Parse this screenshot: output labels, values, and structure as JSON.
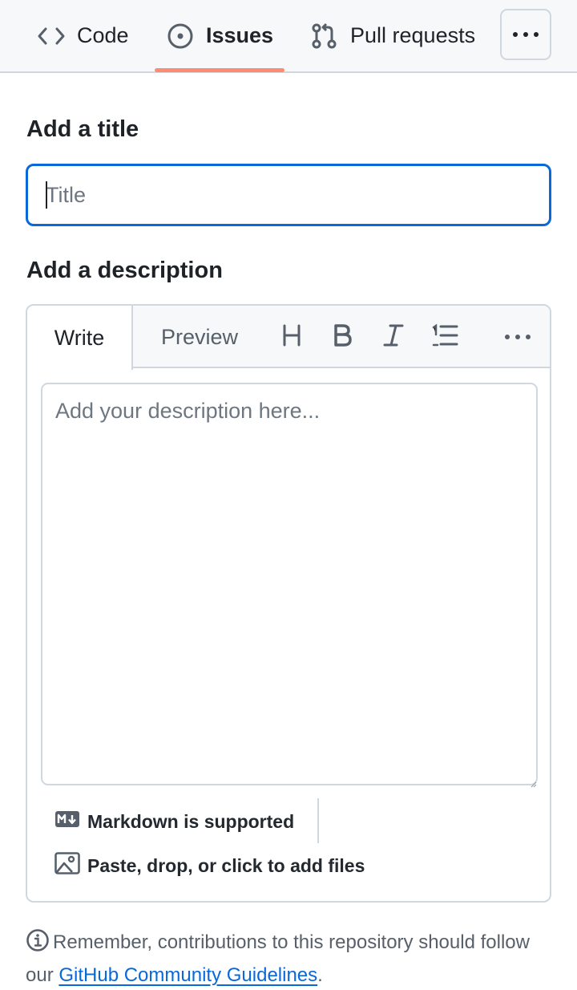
{
  "nav": {
    "tabs": [
      {
        "label": "Code",
        "icon": "code-icon"
      },
      {
        "label": "Issues",
        "icon": "issue-opened-icon",
        "selected": true
      },
      {
        "label": "Pull requests",
        "icon": "git-pull-request-icon"
      }
    ],
    "more_icon": "kebab-horizontal-icon",
    "accent_color": "#fd8c73"
  },
  "form": {
    "title_heading": "Add a title",
    "title_placeholder": "Title",
    "title_value": "",
    "description_heading": "Add a description",
    "description_placeholder": "Add your description here...",
    "description_value": ""
  },
  "editor": {
    "write_tab": "Write",
    "preview_tab": "Preview",
    "toolbar_icons": [
      "heading-icon",
      "bold-icon",
      "italic-icon",
      "list-ordered-icon",
      "kebab-horizontal-icon"
    ],
    "markdown_note": "Markdown is supported",
    "files_note": "Paste, drop, or click to add files"
  },
  "footer": {
    "note_prefix": "Remember, contributions to this repository should follow our ",
    "link_text": "GitHub Community Guidelines",
    "note_suffix": ".",
    "link_color": "#0969da"
  }
}
